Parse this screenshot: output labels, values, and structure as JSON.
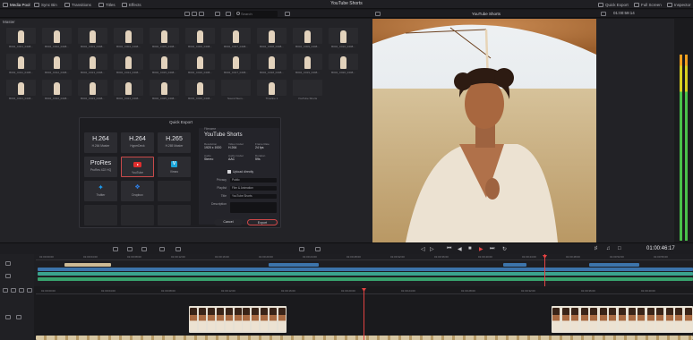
{
  "topbar": {
    "items": [
      {
        "label": "Media Pool",
        "icon": "media-pool-icon",
        "active": true
      },
      {
        "label": "Sync Bin",
        "icon": "sync-bin-icon",
        "active": false
      },
      {
        "label": "Transitions",
        "icon": "transitions-icon",
        "active": false
      },
      {
        "label": "Titles",
        "icon": "titles-icon",
        "active": false
      },
      {
        "label": "Effects",
        "icon": "effects-icon",
        "active": false
      }
    ],
    "app_title": "YouTube Shorts",
    "right_items": [
      {
        "label": "Quick Export",
        "icon": "quick-export-icon"
      },
      {
        "label": "Full Screen",
        "icon": "full-screen-icon"
      },
      {
        "label": "Inspector",
        "icon": "inspector-icon"
      }
    ]
  },
  "media_pool": {
    "search_placeholder": "Search",
    "bin_label": "Master",
    "clips": [
      {
        "name": "B002_C001_0408...",
        "thumb": "portrait"
      },
      {
        "name": "B002_C002_0408...",
        "thumb": "portrait"
      },
      {
        "name": "B002_C003_0408...",
        "thumb": "portrait"
      },
      {
        "name": "B002_C004_0408...",
        "thumb": "portrait"
      },
      {
        "name": "B002_C005_0408...",
        "thumb": "portrait"
      },
      {
        "name": "B002_C006_0408...",
        "thumb": "portrait"
      },
      {
        "name": "B002_C007_0408...",
        "thumb": "portrait"
      },
      {
        "name": "B002_C008_0408...",
        "thumb": "portrait"
      },
      {
        "name": "B002_C009_0408...",
        "thumb": "portrait"
      },
      {
        "name": "B002_C010_0408...",
        "thumb": "portrait"
      },
      {
        "name": "B002_C011_0408...",
        "thumb": "portrait"
      },
      {
        "name": "B002_C012_0408...",
        "thumb": "portrait"
      },
      {
        "name": "B002_C013_0408...",
        "thumb": "portrait"
      },
      {
        "name": "B002_C014_0408...",
        "thumb": "field"
      },
      {
        "name": "B002_C015_0408...",
        "thumb": "field"
      },
      {
        "name": "B002_C016_0408...",
        "thumb": "field"
      },
      {
        "name": "B002_C017_0408...",
        "thumb": "field"
      },
      {
        "name": "B002_C018_0408...",
        "thumb": "field"
      },
      {
        "name": "B002_C019_0408...",
        "thumb": "field"
      },
      {
        "name": "B002_C020_0408...",
        "thumb": "field"
      },
      {
        "name": "B002_C021_0408...",
        "thumb": "field"
      },
      {
        "name": "B002_C022_0408...",
        "thumb": "field"
      },
      {
        "name": "B002_C023_0408...",
        "thumb": "field"
      },
      {
        "name": "B002_C024_0408...",
        "thumb": "field"
      },
      {
        "name": "B002_C025_0408...",
        "thumb": "field"
      },
      {
        "name": "B002_C026_0408...",
        "thumb": "field"
      },
      {
        "name": "Sound Stem...",
        "thumb": "strip"
      },
      {
        "name": "Timeline 1",
        "thumb": "field"
      },
      {
        "name": "YouTube Shorts",
        "thumb": "red"
      }
    ]
  },
  "quick_export": {
    "title": "Quick Export",
    "presets": [
      {
        "big": "H.264",
        "small": "H.264 Master",
        "icon": "",
        "selected": false
      },
      {
        "big": "H.264",
        "small": "HyperDeck",
        "icon": "",
        "selected": false
      },
      {
        "big": "H.265",
        "small": "H.265 Master",
        "icon": "",
        "selected": false
      },
      {
        "big": "ProRes",
        "small": "ProRes 422 HQ",
        "icon": "",
        "selected": false
      },
      {
        "big": "",
        "small": "YouTube",
        "icon": "youtube-icon",
        "selected": true
      },
      {
        "big": "",
        "small": "Vimeo",
        "icon": "vimeo-icon",
        "selected": false
      },
      {
        "big": "",
        "small": "Twitter",
        "icon": "twitter-icon",
        "selected": false
      },
      {
        "big": "",
        "small": "Dropbox",
        "icon": "dropbox-icon",
        "selected": false
      }
    ],
    "detail": {
      "subtitle": "Filename",
      "title": "YouTube Shorts",
      "specs": [
        {
          "label": "Resolution",
          "value": "1920 x 1920"
        },
        {
          "label": "Video Codec",
          "value": "H.264"
        },
        {
          "label": "Frame Rate",
          "value": "24 fps"
        },
        {
          "label": "Audio",
          "value": "Stereo"
        },
        {
          "label": "Audio Codec",
          "value": "AAC"
        },
        {
          "label": "Duration",
          "value": "59s"
        }
      ],
      "upload_checkbox": "Upload directly",
      "fields": [
        {
          "label": "Privacy",
          "value": "Public"
        },
        {
          "label": "Playlist",
          "value": "Film & Animation"
        },
        {
          "label": "Title",
          "value": "YouTube Shorts"
        },
        {
          "label": "Description",
          "value": ""
        }
      ],
      "cancel": "Cancel",
      "export": "Export"
    }
  },
  "viewer": {
    "title": "YouTube Shorts",
    "timecode_top": "01:00:59:14"
  },
  "transport": {
    "timecode": "01:00:46:17"
  },
  "timeline": {
    "upper_ticks": [
      "01:00:00:00",
      "01:00:04:00",
      "01:00:08:00",
      "01:00:12:00",
      "01:00:16:00",
      "01:00:20:00",
      "01:00:24:00",
      "01:00:28:00",
      "01:00:32:00",
      "01:00:36:00",
      "01:00:40:00",
      "01:00:44:00",
      "01:00:48:00",
      "01:00:52:00",
      "01:00:56:00"
    ],
    "lower_ticks": [
      "01:00:00:00",
      "01:00:04:00",
      "01:00:08:00",
      "01:00:12:00",
      "01:00:16:00",
      "01:00:20:00",
      "01:00:24:00",
      "01:00:28:00",
      "01:00:32:00",
      "01:00:36:00",
      "01:00:40:00"
    ],
    "colors": {
      "beige": "#cdbb96",
      "blue": "#3c74ab",
      "teal": "#3aa38e",
      "green": "#37a06c",
      "playhead": "#e34242"
    }
  }
}
